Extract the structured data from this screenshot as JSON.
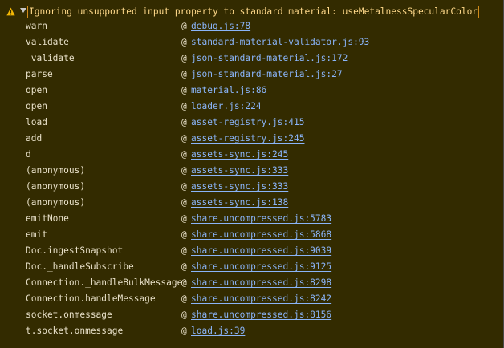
{
  "warning": {
    "message": "Ignoring unsupported input property to standard material: useMetalnessSpecularColor",
    "icon": "warning-triangle-icon",
    "colors": {
      "background": "#332b00",
      "text": "#ffd98a",
      "link": "#8ab4f8",
      "icon": "#f2b705"
    }
  },
  "stack": [
    {
      "fn": "warn",
      "at": "@",
      "loc": "debug.js:78"
    },
    {
      "fn": "validate",
      "at": "@",
      "loc": "standard-material-validator.js:93"
    },
    {
      "fn": "_validate",
      "at": "@",
      "loc": "json-standard-material.js:172"
    },
    {
      "fn": "parse",
      "at": "@",
      "loc": "json-standard-material.js:27"
    },
    {
      "fn": "open",
      "at": "@",
      "loc": "material.js:86"
    },
    {
      "fn": "open",
      "at": "@",
      "loc": "loader.js:224"
    },
    {
      "fn": "load",
      "at": "@",
      "loc": "asset-registry.js:415"
    },
    {
      "fn": "add",
      "at": "@",
      "loc": "asset-registry.js:245"
    },
    {
      "fn": "d",
      "at": "@",
      "loc": "assets-sync.js:245"
    },
    {
      "fn": "(anonymous)",
      "at": "@",
      "loc": "assets-sync.js:333"
    },
    {
      "fn": "(anonymous)",
      "at": "@",
      "loc": "assets-sync.js:333"
    },
    {
      "fn": "(anonymous)",
      "at": "@",
      "loc": "assets-sync.js:138"
    },
    {
      "fn": "emitNone",
      "at": "@",
      "loc": "share.uncompressed.js:5783"
    },
    {
      "fn": "emit",
      "at": "@",
      "loc": "share.uncompressed.js:5868"
    },
    {
      "fn": "Doc.ingestSnapshot",
      "at": "@",
      "loc": "share.uncompressed.js:9039"
    },
    {
      "fn": "Doc._handleSubscribe",
      "at": "@",
      "loc": "share.uncompressed.js:9125"
    },
    {
      "fn": "Connection._handleBulkMessage",
      "at": "@",
      "loc": "share.uncompressed.js:8298"
    },
    {
      "fn": "Connection.handleMessage",
      "at": "@",
      "loc": "share.uncompressed.js:8242"
    },
    {
      "fn": "socket.onmessage",
      "at": "@",
      "loc": "share.uncompressed.js:8156"
    },
    {
      "fn": "t.socket.onmessage",
      "at": "@",
      "loc": "load.js:39"
    }
  ]
}
